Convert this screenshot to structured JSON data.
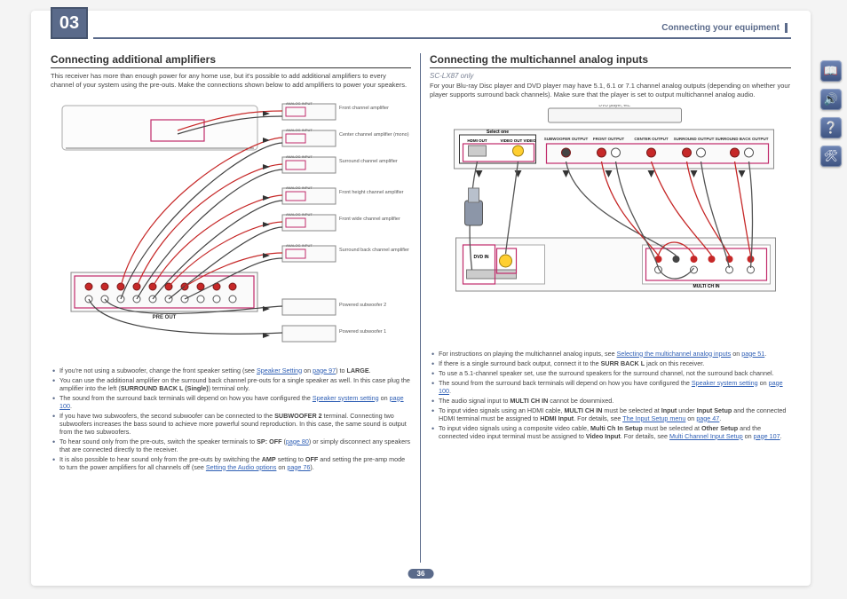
{
  "chapter": "03",
  "header_right": "Connecting your equipment",
  "page_number": "36",
  "left": {
    "heading": "Connecting additional amplifiers",
    "intro": "This receiver has more than enough power for any home use, but it's possible to add additional amplifiers to every channel of your system using the pre-outs. Make the connections shown below to add amplifiers to power your speakers.",
    "amp_labels": [
      "Front channel amplifier",
      "Center channel amplifier (mono)",
      "Surround channel amplifier",
      "Front height channel amplifier",
      "Front wide channel amplifier",
      "Surround back channel amplifier",
      "Powered subwoofer 2",
      "Powered subwoofer 1"
    ],
    "preout_caption": "PRE OUT",
    "analog_input": "ANALOG INPUT",
    "notes": [
      "If you're not using a subwoofer, change the front speaker setting (see <span class='link'>Speaker Setting</span> on <span class='link'>page 97</span>) to <b>LARGE</b>.",
      "You can use the additional amplifier on the surround back channel pre-outs for a single speaker as well. In this case plug the amplifier into the left (<b>SURROUND BACK L (Single)</b>) terminal only.",
      "The sound from the surround back terminals will depend on how you have configured the <span class='link'>Speaker system setting</span> on <span class='link'>page 100</span>.",
      "If you have two subwoofers, the second subwoofer can be connected to the <b>SUBWOOFER 2</b> terminal. Connecting two subwoofers increases the bass sound to achieve more powerful sound reproduction. In this case, the same sound is output from the two subwoofers.",
      "To hear sound only from the pre-outs, switch the speaker terminals to <b>SP: OFF</b> (<span class='link'>page 80</span>) or simply disconnect any speakers that are connected directly to the receiver.",
      "It is also possible to hear sound only from the pre-outs by switching the <b>AMP</b> setting to <b>OFF</b> and setting the pre-amp mode to turn the power amplifiers for all channels off (see <span class='link'>Setting the Audio options</span> on <span class='link'>page 76</span>)."
    ]
  },
  "right": {
    "heading": "Connecting the multichannel analog inputs",
    "subnote": "SC-LX87 only",
    "intro": "For your Blu-ray Disc player and DVD player may have 5.1, 6.1 or 7.1 channel analog outputs (depending on whether your player supports surround back channels). Make sure that the player is set to output multichannel analog audio.",
    "diagram_labels": {
      "top_device": "DVD player, etc.",
      "select_one": "Select one",
      "hdmi_out": "HDMI OUT",
      "video_out": "VIDEO OUT VIDEO",
      "subwoofer": "SUBWOOFER OUTPUT",
      "front": "FRONT OUTPUT",
      "center": "CENTER OUTPUT",
      "surround": "SURROUND OUTPUT",
      "surround_back": "SURROUND BACK OUTPUT",
      "dvd_in": "DVD IN",
      "multi_ch_in": "MULTI CH IN"
    },
    "notes": [
      "For instructions on playing the multichannel analog inputs, see <span class='link'>Selecting the multichannel analog inputs</span> on <span class='link'>page 51</span>.",
      "If there is a single surround back output, connect it to the <b>SURR BACK L</b> jack on this receiver.",
      "To use a 5.1-channel speaker set, use the surround speakers for the surround channel, not the surround back channel.",
      "The sound from the surround back terminals will depend on how you have configured the <span class='link'>Speaker system setting</span> on <span class='link'>page 100</span>.",
      "The audio signal input to <b>MULTI CH IN</b> cannot be downmixed.",
      "To input video signals using an HDMI cable, <b>MULTI CH IN</b> must be selected at <b>Input</b> under <b>Input Setup</b> and the connected HDMI terminal must be assigned to <b>HDMI Input</b>. For details, see <span class='link'>The Input Setup menu</span> on <span class='link'>page 47</span>.",
      "To input video signals using a composite video cable, <b>Multi Ch In Setup</b> must be selected at <b>Other Setup</b> and the connected video input terminal must be assigned to <b>Video Input</b>. For details, see <span class='link'>Multi Channel Input Setup</span> on <span class='link'>page 107</span>."
    ]
  },
  "rail_icons": [
    "book-icon",
    "speaker-icon",
    "help-icon",
    "tools-icon"
  ]
}
